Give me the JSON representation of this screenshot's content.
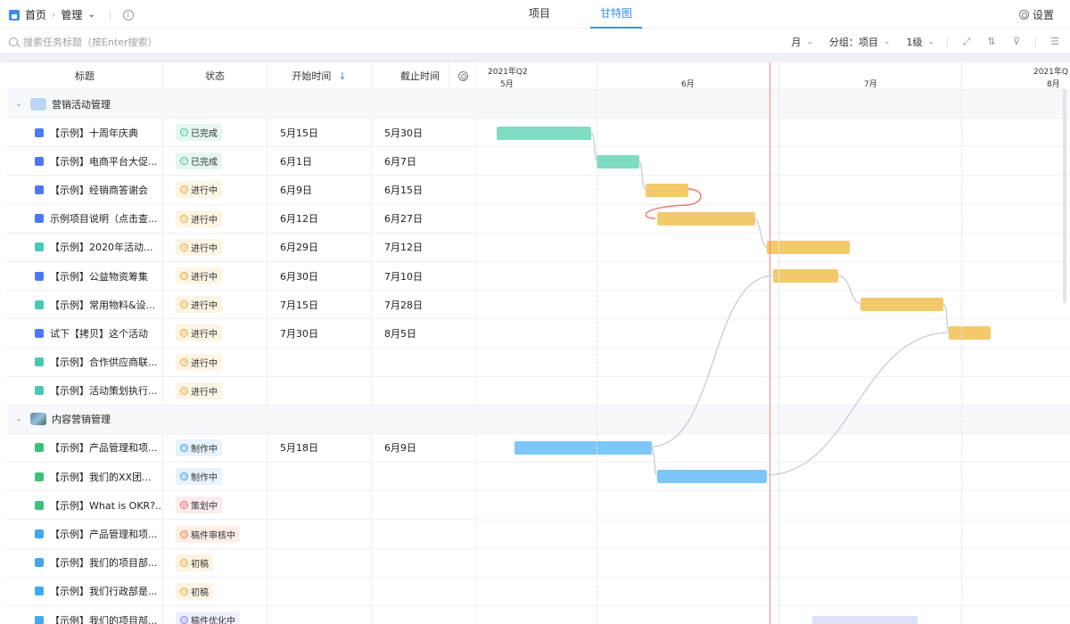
{
  "topbar": {
    "home_label": "首页",
    "manage_label": "管理",
    "tabs": [
      {
        "label": "项目",
        "active": false
      },
      {
        "label": "甘特图",
        "active": true
      }
    ],
    "settings_label": "设置"
  },
  "toolbar": {
    "search_placeholder": "搜索任务标题（按Enter搜索）",
    "scale": "月",
    "group_label": "分组：项目",
    "level": "1级"
  },
  "table": {
    "headers": {
      "title": "标题",
      "status": "状态",
      "start": "开始时间",
      "end": "截止时间"
    },
    "groups": [
      {
        "name": "营销活动管理",
        "icon": "mail-icon",
        "rows": [
          {
            "icon": "blue",
            "title": "【示例】十周年庆典",
            "status": "已完成",
            "status_kind": "done",
            "start": "5月15日",
            "end": "5月30日"
          },
          {
            "icon": "blue",
            "title": "【示例】电商平台大促...",
            "status": "已完成",
            "status_kind": "done",
            "start": "6月1日",
            "end": "6月7日"
          },
          {
            "icon": "blue",
            "title": "【示例】经销商答谢会",
            "status": "进行中",
            "status_kind": "doing",
            "start": "6月9日",
            "end": "6月15日"
          },
          {
            "icon": "blue",
            "title": "示例项目说明（点击查...",
            "status": "进行中",
            "status_kind": "doing",
            "start": "6月12日",
            "end": "6月27日"
          },
          {
            "icon": "teal",
            "title": "【示例】2020年活动...",
            "status": "进行中",
            "status_kind": "doing",
            "start": "6月29日",
            "end": "7月12日"
          },
          {
            "icon": "blue",
            "title": "【示例】公益物资筹集",
            "status": "进行中",
            "status_kind": "doing",
            "start": "6月30日",
            "end": "7月10日"
          },
          {
            "icon": "teal",
            "title": "【示例】常用物料&设...",
            "status": "进行中",
            "status_kind": "doing",
            "start": "7月15日",
            "end": "7月28日"
          },
          {
            "icon": "blue",
            "title": "试下【拷贝】这个活动",
            "status": "进行中",
            "status_kind": "doing",
            "start": "7月30日",
            "end": "8月5日"
          },
          {
            "icon": "teal",
            "title": "【示例】合作供应商联...",
            "status": "进行中",
            "status_kind": "doing",
            "start": "",
            "end": ""
          },
          {
            "icon": "teal",
            "title": "【示例】活动策划执行...",
            "status": "进行中",
            "status_kind": "doing",
            "start": "",
            "end": ""
          }
        ]
      },
      {
        "name": "内容营销管理",
        "icon": "photo-icon",
        "rows": [
          {
            "icon": "green",
            "title": "【示例】产品管理和项...",
            "status": "制作中",
            "status_kind": "make",
            "start": "5月18日",
            "end": "6月9日"
          },
          {
            "icon": "green",
            "title": "【示例】我们的XX团...",
            "status": "制作中",
            "status_kind": "make",
            "start": "",
            "end": ""
          },
          {
            "icon": "green",
            "title": "【示例】What is OKR?...",
            "status": "策划中",
            "status_kind": "plan",
            "start": "",
            "end": ""
          },
          {
            "icon": "sky",
            "title": "【示例】产品管理和项...",
            "status": "稿件审核中",
            "status_kind": "review",
            "start": "",
            "end": ""
          },
          {
            "icon": "sky",
            "title": "【示例】我们的项目部...",
            "status": "初稿",
            "status_kind": "draft",
            "start": "",
            "end": ""
          },
          {
            "icon": "sky",
            "title": "【示例】我们行政部是...",
            "status": "初稿",
            "status_kind": "draft",
            "start": "",
            "end": ""
          },
          {
            "icon": "sky",
            "title": "【示例】我们的项目部...",
            "status": "稿件优化中",
            "status_kind": "opt",
            "start": "",
            "end": ""
          }
        ]
      }
    ]
  },
  "gantt": {
    "quarter_left": "2021年Q2",
    "quarter_right": "2021年Q",
    "months": [
      "5月",
      "6月",
      "7月",
      "8月"
    ],
    "colors": {
      "done": "#7fdcc2",
      "doing": "#f2c96b",
      "make": "#7cc7f7",
      "today": "#f08a7a"
    }
  }
}
